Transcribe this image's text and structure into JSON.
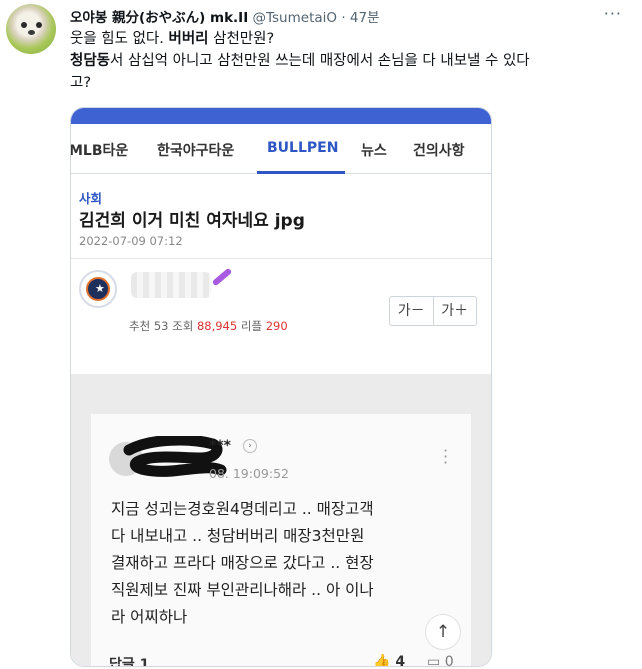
{
  "tweet": {
    "display_name": "오야봉 親分(おやぶん) mk.II",
    "handle": "@TsumetaiO",
    "separator": "·",
    "time": "47분",
    "more_icon": "ellipsis-icon",
    "text_line1_a": "웃을 힘도 없다. ",
    "text_line1_b": "버버리",
    "text_line1_c": " 삼천만원?",
    "text_line2_a": "청담동",
    "text_line2_b": "서 삼십억 아니고 삼천만원 쓰는데 매장에서 손님을 다 내보낼 수 있다",
    "text_line3": "고?"
  },
  "embedded": {
    "tabs": [
      "MLB타운",
      "한국야구타운",
      "BULLPEN",
      "뉴스",
      "건의사항"
    ],
    "active_tab": "BULLPEN",
    "accent": "#2d56c4",
    "post": {
      "category": "사회",
      "title": "김건희 이거 미친 여자네요 jpg",
      "date": "2022-07-09 07:12",
      "recommend_label": "추천",
      "recommend": "53",
      "views_label": "조회",
      "views": "88,945",
      "replies_label": "리플",
      "replies": "290",
      "font_smaller": "가－",
      "font_bigger": "가＋"
    },
    "comment": {
      "masked_name": "***",
      "time": "08. 19:09:52",
      "lines": [
        "지금 성괴는경호원4명데리고 .. 매장고객",
        "다 내보내고 .. 청담버버리 매장3천만원",
        "결재하고 프라다 매장으로 갔다고 .. 현장",
        "직원제보 진짜 부인관리나해라 .. 아 이나",
        "라 어찌하나"
      ],
      "reply_label": "답글 1",
      "likes": "4",
      "dislikes": "0",
      "scroll_top_icon": "arrow-up-icon"
    }
  }
}
